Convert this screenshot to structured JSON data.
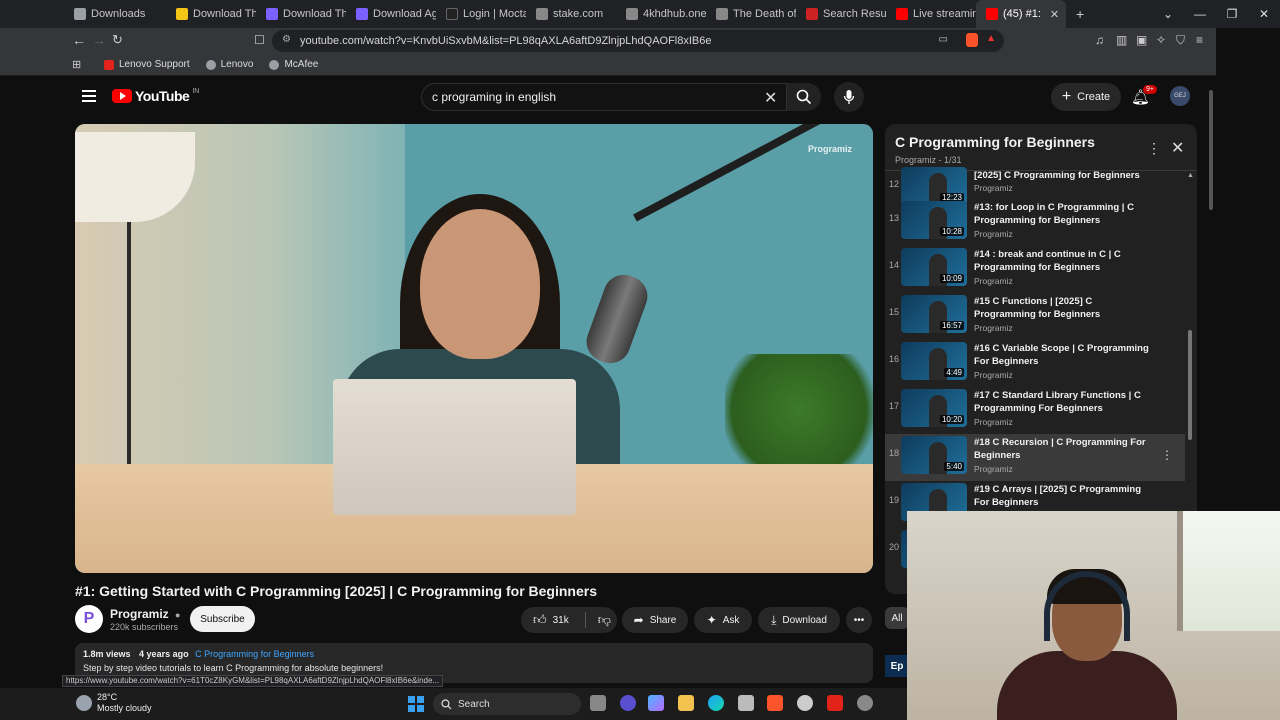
{
  "browser": {
    "tabs": [
      {
        "label": "Downloads",
        "color": "#9aa0a6"
      },
      {
        "label": "Download The",
        "color": "#f5c518"
      },
      {
        "label": "Download The",
        "color": "#7b61ff"
      },
      {
        "label": "Download Age",
        "color": "#7b61ff"
      },
      {
        "label": "Login | Moctale",
        "color": "#222222"
      },
      {
        "label": "stake.com",
        "color": "#888888"
      },
      {
        "label": "4khdhub.one/",
        "color": "#888888"
      },
      {
        "label": "The Death of R",
        "color": "#888888"
      },
      {
        "label": "Search Results",
        "color": "#cc2222"
      },
      {
        "label": "Live streaming",
        "color": "#ff0000"
      },
      {
        "label": "(45) #1:",
        "color": "#ff0000",
        "active": true
      }
    ],
    "url": "youtube.com/watch?v=KnvbUiSxvbM&list=PL98qAXLA6aftD9ZlnjpLhdQAOFl8xIB6e",
    "bookmarks": [
      {
        "label": "Lenovo Support",
        "color": "#e2231a"
      },
      {
        "label": "Lenovo",
        "color": "#9aa0a6"
      },
      {
        "label": "McAfee",
        "color": "#9aa0a6"
      }
    ],
    "status_url": "https://www.youtube.com/watch?v=61T0cZ8KyGM&list=PL98qAXLA6aftD9ZlnjpLhdQAOFl8xIB6e&inde..."
  },
  "yt": {
    "logo_text": "YouTube",
    "country": "IN",
    "search_value": "c programing in english",
    "create_label": "Create",
    "notif_badge": "9+",
    "avatar_text": "GEJ"
  },
  "video": {
    "watermark": "Programiz",
    "title": "#1: Getting Started with C Programming [2025] | C Programming for Beginners",
    "channel": "Programiz",
    "subscribers": "220k subscribers",
    "subscribe_label": "Subscribe",
    "likes": "31k",
    "share_label": "Share",
    "ask_label": "Ask",
    "download_label": "Download",
    "views": "1.8m views",
    "age": "4 years ago",
    "playlist_link": "C Programming for Beginners",
    "description": "Step by step video tutorials to learn C Programming for absolute beginners!"
  },
  "playlist": {
    "title": "C Programming for Beginners",
    "subtitle": "Programiz - 1/31",
    "items": [
      {
        "num": "12",
        "title": "[2025] C Programming for Beginners",
        "channel": "Programiz",
        "duration": "12:23"
      },
      {
        "num": "13",
        "title": "#13: for Loop in C Programming | C Programming for Beginners",
        "channel": "Programiz",
        "duration": "10:28"
      },
      {
        "num": "14",
        "title": "#14 : break and continue in C | C Programming for Beginners",
        "channel": "Programiz",
        "duration": "10:09"
      },
      {
        "num": "15",
        "title": "#15 C Functions | [2025] C Programming for Beginners",
        "channel": "Programiz",
        "duration": "16:57"
      },
      {
        "num": "16",
        "title": "#16 C Variable Scope | C Programming For Beginners",
        "channel": "Programiz",
        "duration": "4:49"
      },
      {
        "num": "17",
        "title": "#17 C Standard Library Functions | C Programming For Beginners",
        "channel": "Programiz",
        "duration": "10:20"
      },
      {
        "num": "18",
        "title": "#18 C Recursion | C Programming For Beginners",
        "channel": "Programiz",
        "duration": "5:40"
      },
      {
        "num": "19",
        "title": "#19 C Arrays | [2025] C Programming For Beginners",
        "channel": "",
        "duration": ""
      },
      {
        "num": "20",
        "title": "",
        "channel": "",
        "duration": ""
      }
    ],
    "chip_all": "All",
    "ep_label": "Ep"
  },
  "taskbar": {
    "temperature": "28°C",
    "weather": "Mostly cloudy",
    "search_label": "Search"
  }
}
